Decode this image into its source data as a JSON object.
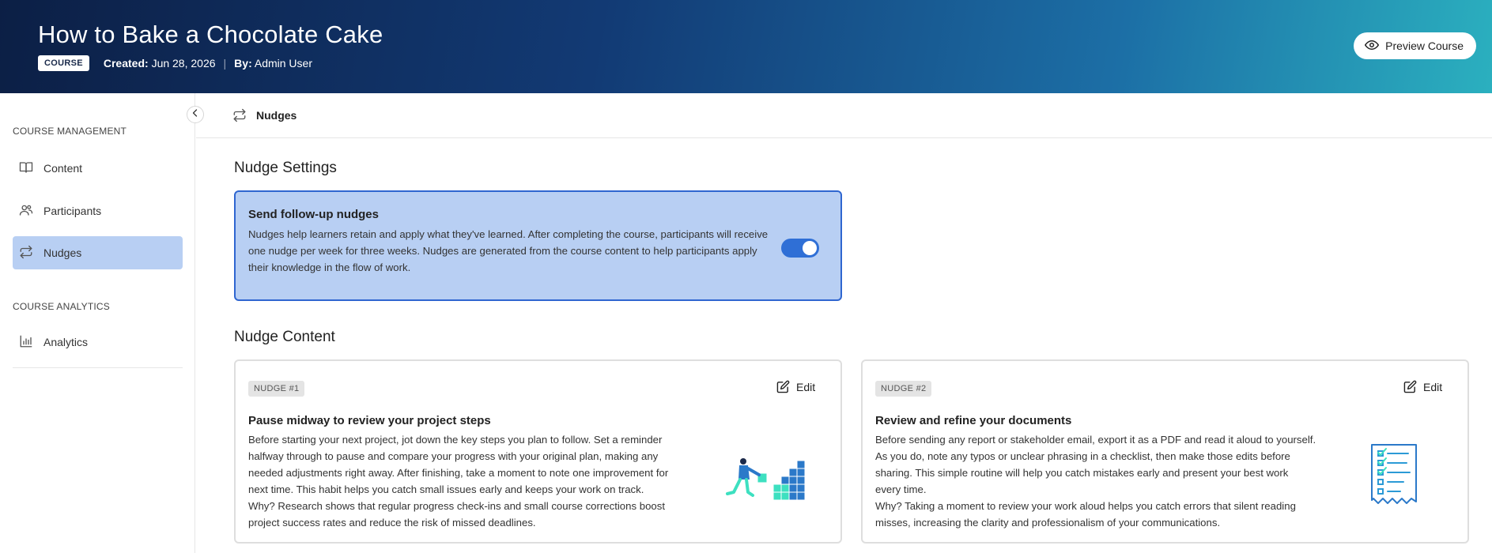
{
  "header": {
    "title": "How to Bake a Chocolate Cake",
    "badge": "COURSE",
    "created_label": "Created:",
    "created_value": "Jun 28, 2026",
    "by_label": "By:",
    "by_value": "Admin User",
    "preview_label": "Preview Course"
  },
  "sidebar": {
    "management_label": "COURSE MANAGEMENT",
    "items": [
      {
        "label": "Content",
        "icon": "book-icon"
      },
      {
        "label": "Participants",
        "icon": "users-icon"
      },
      {
        "label": "Nudges",
        "icon": "repeat-icon",
        "active": true
      }
    ],
    "analytics_label": "COURSE ANALYTICS",
    "analytics_items": [
      {
        "label": "Analytics",
        "icon": "bar-chart-icon"
      }
    ]
  },
  "topbar": {
    "label": "Nudges"
  },
  "settings": {
    "heading": "Nudge Settings",
    "title": "Send follow-up nudges",
    "description": "Nudges help learners retain and apply what they've learned. After completing the course, participants will receive one nudge per week for three weeks. Nudges are generated from the course content to help participants apply their knowledge in the flow of work.",
    "enabled": true
  },
  "content": {
    "heading": "Nudge Content",
    "edit_label": "Edit",
    "nudges": [
      {
        "tag": "NUDGE #1",
        "title": "Pause midway to review your project steps",
        "lines": [
          "Before starting your next project, jot down the key steps you plan to follow. Set a reminder",
          "halfway through to pause and compare your progress with your original plan, making any",
          "needed adjustments right away. After finishing, take a moment to note one improvement for",
          "next time. This habit helps you catch small issues early and keeps your work on track.",
          "Why? Research shows that regular progress check-ins and small course corrections boost",
          "project success rates and reduce the risk of missed deadlines."
        ]
      },
      {
        "tag": "NUDGE #2",
        "title": "Review and refine your documents",
        "lines": [
          "Before sending any report or stakeholder email, export it as a PDF and read it aloud to yourself.",
          "As you do, note any typos or unclear phrasing in a checklist, then make those edits before",
          "sharing. This simple routine will help you catch mistakes early and present your best work",
          "every time.",
          "Why? Taking a moment to review your work aloud helps you catch errors that silent reading",
          "misses, increasing the clarity and professionalism of your communications."
        ]
      }
    ]
  },
  "colors": {
    "accent": "#2f66d0",
    "highlight": "#b8cff3",
    "toggle_on": "#2f6fd6"
  }
}
